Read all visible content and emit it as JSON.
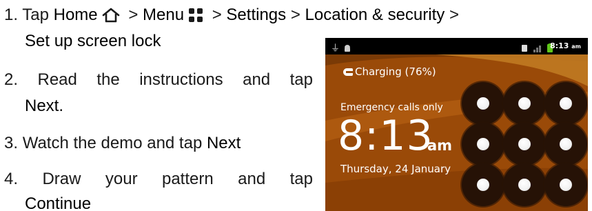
{
  "steps": {
    "s1": {
      "number": "1.",
      "prefix": "Tap",
      "home": "Home",
      "sep1": ">",
      "menu": "Menu",
      "sep2": ">",
      "settings": "Settings",
      "sep3": ">",
      "location": "Location & security",
      "sep4": ">",
      "cont": "Set up screen lock"
    },
    "s2": {
      "number": "2.",
      "words": [
        "Read",
        "the",
        "instructions",
        "and",
        "tap"
      ],
      "cont": "Next",
      "cont_suffix": "."
    },
    "s3": {
      "number": "3.",
      "text": "Watch the demo and tap",
      "button": "Next"
    },
    "s4": {
      "number": "4.",
      "words": [
        "Draw",
        "your",
        "pattern",
        "and",
        "tap"
      ],
      "cont": "Continue"
    }
  },
  "icons": {
    "home": "home-icon",
    "menu": "menu-grid-icon"
  },
  "phone": {
    "status_time": "8:13",
    "status_ampm": "am",
    "charging": "Charging (76%)",
    "emergency": "Emergency calls only",
    "time": "8:13",
    "ampm": "am",
    "date": "Thursday, 24 January",
    "pattern_grid": "3x3"
  },
  "colors": {
    "lockscreen_bg": "#9a4a08",
    "status_bar": "#000000",
    "dot_ring": "#261206"
  }
}
